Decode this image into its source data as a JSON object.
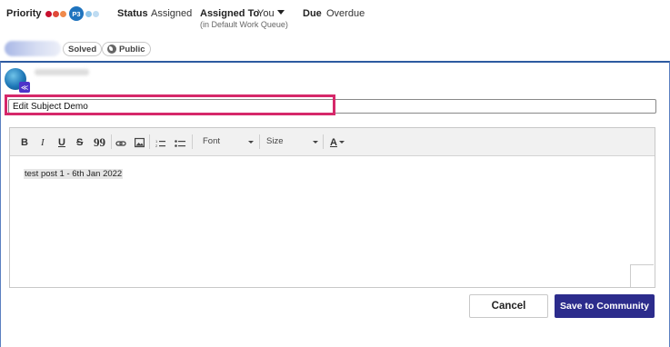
{
  "meta": {
    "priority_label": "Priority",
    "priority_badge": "P3",
    "priority_dots": [
      "#c8102e",
      "#e04a3a",
      "#f08a4b",
      "#1e73be",
      "#8ec5ea",
      "#bfdcf2"
    ],
    "status_label": "Status",
    "status_value": "Assigned",
    "assigned_label": "Assigned To",
    "assigned_value": "You",
    "assigned_sub": "(in Default Work Queue)",
    "due_label": "Due",
    "due_value": "Overdue"
  },
  "tags": {
    "solved": "Solved",
    "public": "Public"
  },
  "editor": {
    "subject_value": "Edit Subject Demo",
    "toolbar": {
      "bold": "B",
      "italic": "I",
      "underline": "U",
      "strike": "S",
      "quote": "99",
      "font_label": "Font",
      "size_label": "Size",
      "color_label": "A"
    },
    "body_text": "test post 1 - 6th Jan 2022"
  },
  "actions": {
    "cancel": "Cancel",
    "save": "Save to Community"
  },
  "colors": {
    "accent": "#2c2c8c",
    "highlight": "#d6286a",
    "panel_border": "#2c5aa0"
  }
}
